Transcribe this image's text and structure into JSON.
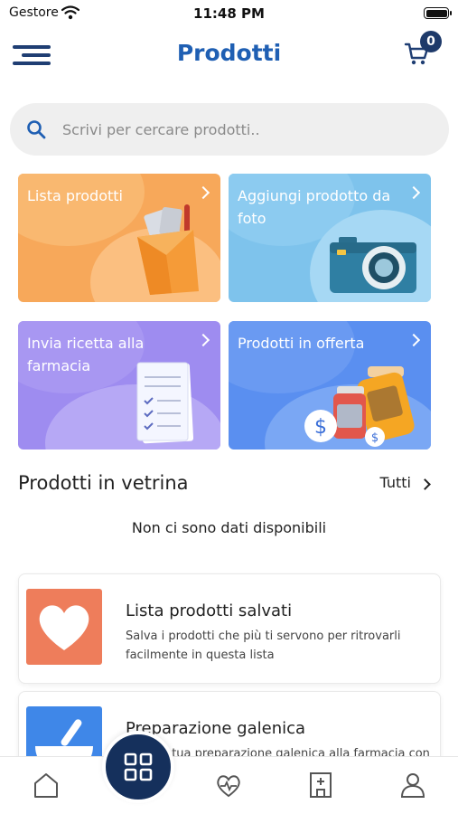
{
  "status_bar": {
    "carrier": "Gestore",
    "time": "11:48 PM"
  },
  "header": {
    "title": "Prodotti",
    "cart_count": "0"
  },
  "search": {
    "placeholder": "Scrivi per cercare prodotti.."
  },
  "tiles": [
    {
      "label": "Lista prodotti",
      "color": "#f7a85a",
      "icon": "medicine-bag-icon"
    },
    {
      "label": "Aggiungi prodotto da foto",
      "color": "#7ec3ec",
      "icon": "camera-icon"
    },
    {
      "label": "Invia ricetta alla farmacia",
      "color": "#9e8cf0",
      "icon": "prescription-icon"
    },
    {
      "label": "Prodotti in offerta",
      "color": "#5a8ff0",
      "icon": "offer-jars-icon"
    }
  ],
  "vetrina": {
    "title": "Prodotti in vetrina",
    "all_label": "Tutti",
    "empty_message": "Non ci sono dati disponibili"
  },
  "cards": [
    {
      "title": "Lista prodotti salvati",
      "description": "Salva i prodotti che più ti servono per ritrovarli facilmente in questa lista",
      "icon": "heart-icon"
    },
    {
      "title": "Preparazione galenica",
      "description": "Invia la tua preparazione galenica alla farmacia con una fotografia aggiungendo anche un",
      "icon": "mortar-icon"
    }
  ],
  "tabbar": {
    "items": [
      "home-icon",
      "grid-icon",
      "heart-pulse-icon",
      "pharmacy-icon",
      "profile-icon"
    ],
    "active": "grid-icon"
  }
}
